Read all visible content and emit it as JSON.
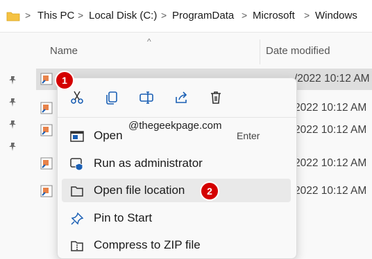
{
  "breadcrumb": {
    "items": [
      "This PC",
      "Local Disk (C:)",
      "ProgramData",
      "Microsoft",
      "Windows"
    ],
    "separator": ">"
  },
  "columns": {
    "name": "Name",
    "date_modified": "Date modified"
  },
  "rows": [
    {
      "date": "/2022 10:12 AM"
    },
    {
      "date": "2022 10:12 AM"
    },
    {
      "date": "2022 10:12 AM"
    },
    {
      "date": "2022 10:12 AM"
    },
    {
      "date": "2022 10:12 AM"
    }
  ],
  "context_menu": {
    "quick_actions": [
      "cut-icon",
      "copy-icon",
      "rename-icon",
      "share-icon",
      "delete-icon"
    ],
    "watermark": "@thegeekpage.com",
    "items": [
      {
        "label": "Open",
        "shortcut": "Enter",
        "icon": "open-app-icon"
      },
      {
        "label": "Run as administrator",
        "icon": "shield-icon"
      },
      {
        "label": "Open file location",
        "icon": "folder-icon"
      },
      {
        "label": "Pin to Start",
        "icon": "pin-icon"
      },
      {
        "label": "Compress to ZIP file",
        "icon": "zip-icon"
      }
    ]
  },
  "annotations": {
    "step1": "1",
    "step2": "2"
  },
  "colors": {
    "accent": "#0067c0",
    "badge": "#d40000",
    "folder": "#f5c242"
  }
}
